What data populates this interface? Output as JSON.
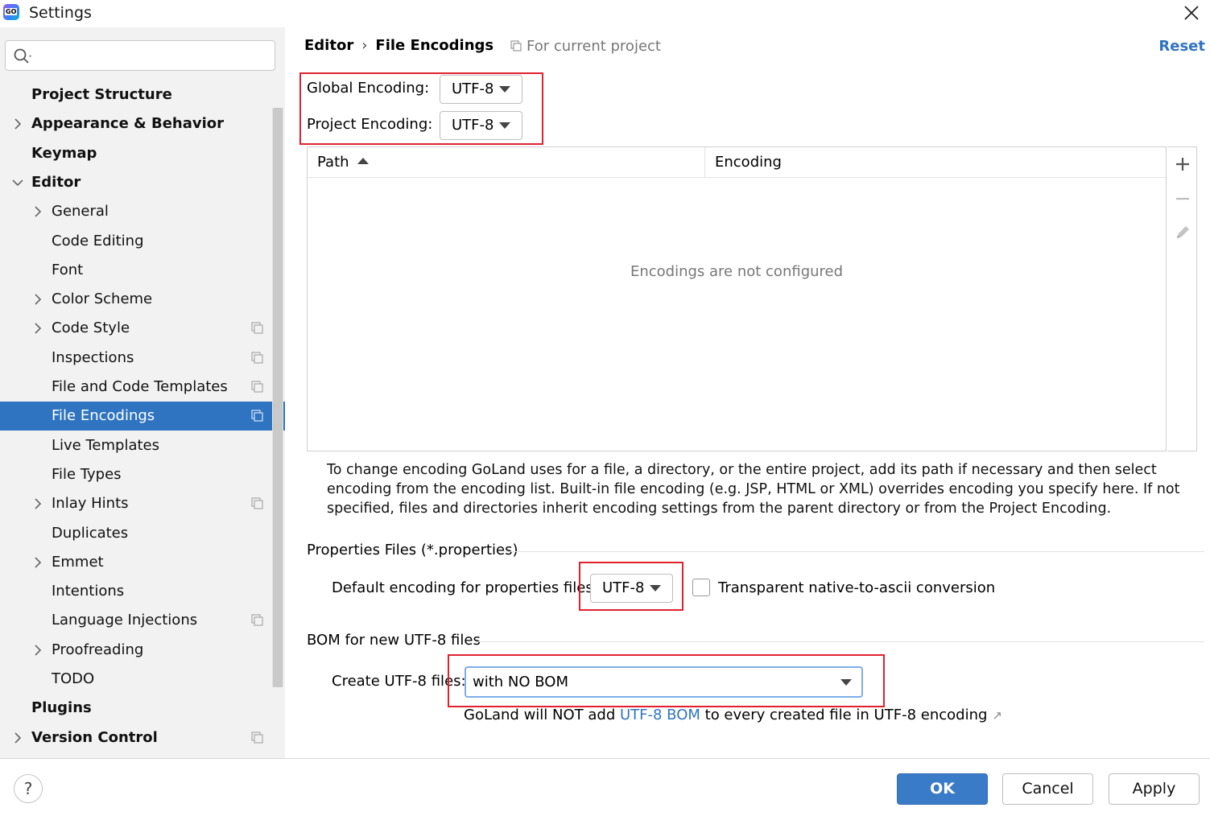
{
  "window": {
    "title": "Settings"
  },
  "search": {
    "placeholder": "",
    "value": ""
  },
  "sidebar": {
    "items": [
      {
        "label": "Project Structure",
        "bold": true,
        "level": 0,
        "chevron": "none",
        "copy_icon": false,
        "selected": false
      },
      {
        "label": "Appearance & Behavior",
        "bold": true,
        "level": 0,
        "chevron": "right",
        "copy_icon": false,
        "selected": false
      },
      {
        "label": "Keymap",
        "bold": true,
        "level": 0,
        "chevron": "none",
        "copy_icon": false,
        "selected": false
      },
      {
        "label": "Editor",
        "bold": true,
        "level": 0,
        "chevron": "down",
        "copy_icon": false,
        "selected": false
      },
      {
        "label": "General",
        "bold": false,
        "level": 1,
        "chevron": "right",
        "copy_icon": false,
        "selected": false
      },
      {
        "label": "Code Editing",
        "bold": false,
        "level": 1,
        "chevron": "none",
        "copy_icon": false,
        "selected": false
      },
      {
        "label": "Font",
        "bold": false,
        "level": 1,
        "chevron": "none",
        "copy_icon": false,
        "selected": false
      },
      {
        "label": "Color Scheme",
        "bold": false,
        "level": 1,
        "chevron": "right",
        "copy_icon": false,
        "selected": false
      },
      {
        "label": "Code Style",
        "bold": false,
        "level": 1,
        "chevron": "right",
        "copy_icon": true,
        "selected": false
      },
      {
        "label": "Inspections",
        "bold": false,
        "level": 1,
        "chevron": "none",
        "copy_icon": true,
        "selected": false
      },
      {
        "label": "File and Code Templates",
        "bold": false,
        "level": 1,
        "chevron": "none",
        "copy_icon": true,
        "selected": false
      },
      {
        "label": "File Encodings",
        "bold": false,
        "level": 1,
        "chevron": "none",
        "copy_icon": true,
        "selected": true
      },
      {
        "label": "Live Templates",
        "bold": false,
        "level": 1,
        "chevron": "none",
        "copy_icon": false,
        "selected": false
      },
      {
        "label": "File Types",
        "bold": false,
        "level": 1,
        "chevron": "none",
        "copy_icon": false,
        "selected": false
      },
      {
        "label": "Inlay Hints",
        "bold": false,
        "level": 1,
        "chevron": "right",
        "copy_icon": true,
        "selected": false
      },
      {
        "label": "Duplicates",
        "bold": false,
        "level": 1,
        "chevron": "none",
        "copy_icon": false,
        "selected": false
      },
      {
        "label": "Emmet",
        "bold": false,
        "level": 1,
        "chevron": "right",
        "copy_icon": false,
        "selected": false
      },
      {
        "label": "Intentions",
        "bold": false,
        "level": 1,
        "chevron": "none",
        "copy_icon": false,
        "selected": false
      },
      {
        "label": "Language Injections",
        "bold": false,
        "level": 1,
        "chevron": "none",
        "copy_icon": true,
        "selected": false
      },
      {
        "label": "Proofreading",
        "bold": false,
        "level": 1,
        "chevron": "right",
        "copy_icon": false,
        "selected": false
      },
      {
        "label": "TODO",
        "bold": false,
        "level": 1,
        "chevron": "none",
        "copy_icon": false,
        "selected": false
      },
      {
        "label": "Plugins",
        "bold": true,
        "level": 0,
        "chevron": "none",
        "copy_icon": false,
        "selected": false
      },
      {
        "label": "Version Control",
        "bold": true,
        "level": 0,
        "chevron": "right",
        "copy_icon": true,
        "selected": false
      }
    ]
  },
  "header": {
    "breadcrumb_parent": "Editor",
    "breadcrumb_separator": "›",
    "breadcrumb_current": "File Encodings",
    "scope_note": "For current project",
    "reset_label": "Reset"
  },
  "encodings": {
    "global_label": "Global Encoding:",
    "global_value": "UTF-8",
    "project_label": "Project Encoding:",
    "project_value": "UTF-8"
  },
  "table": {
    "columns": [
      "Path",
      "Encoding"
    ],
    "sorted_column": "Path",
    "sort_direction": "ascending",
    "empty_text": "Encodings are not configured",
    "tools": [
      "add-icon",
      "remove-icon",
      "edit-icon"
    ]
  },
  "help_text": "To change encoding GoLand uses for a file, a directory, or the entire project, add its path if necessary and then select encoding from the encoding list. Built-in file encoding (e.g. JSP, HTML or XML) overrides encoding you specify here. If not specified, files and directories inherit encoding settings from the parent directory or from the Project Encoding.",
  "properties": {
    "section_title": "Properties Files (*.properties)",
    "default_label": "Default encoding for properties files:",
    "default_value": "UTF-8",
    "transparent_label": "Transparent native-to-ascii conversion",
    "transparent_checked": false
  },
  "bom": {
    "section_title": "BOM for new UTF-8 files",
    "create_label": "Create UTF-8 files:",
    "create_value": "with NO BOM",
    "note_prefix": "GoLand will NOT add ",
    "note_link": "UTF-8 BOM",
    "note_suffix": " to every created file in UTF-8 encoding",
    "note_ext_icon": "↗"
  },
  "footer": {
    "help_label": "?",
    "ok_label": "OK",
    "cancel_label": "Cancel",
    "apply_label": "Apply"
  },
  "colors": {
    "accent": "#2f74c0",
    "selection": "#2f74c0",
    "highlight_box": "#e0212e",
    "sidebar_bg": "#f2f2f2"
  }
}
